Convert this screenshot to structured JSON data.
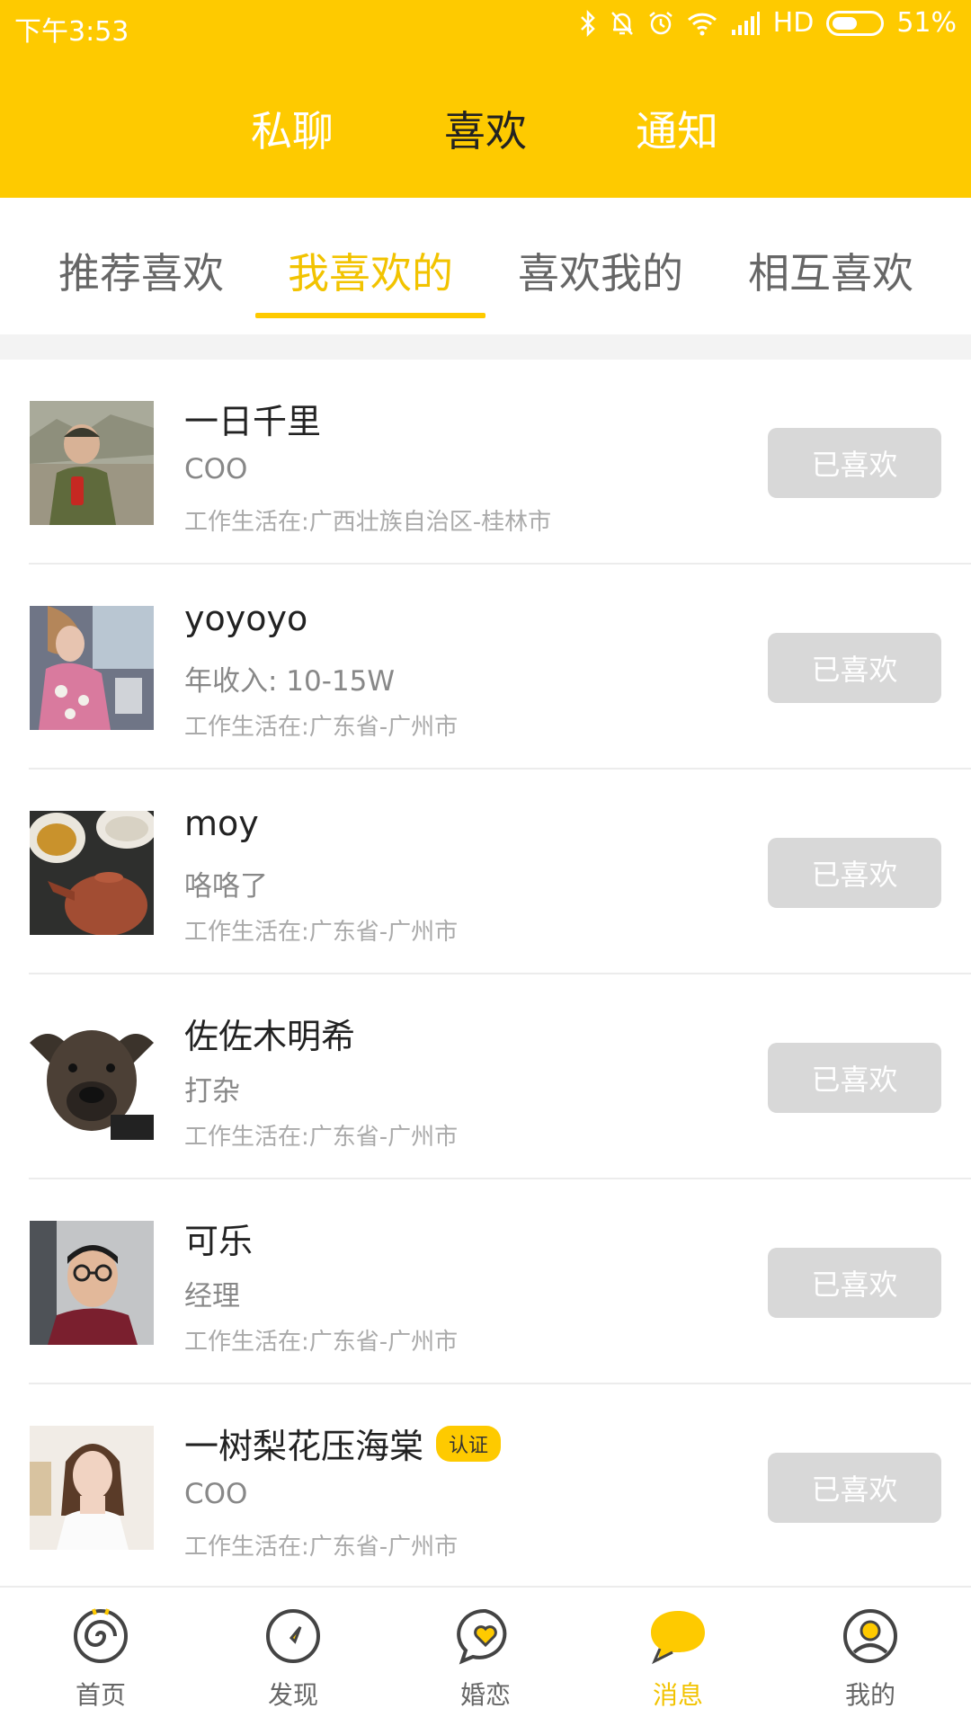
{
  "status_bar": {
    "time": "下午3:53",
    "network": "HD",
    "battery": "51%",
    "battery_level": 0.51
  },
  "top_tabs": [
    {
      "label": "私聊",
      "active": false
    },
    {
      "label": "喜欢",
      "active": true
    },
    {
      "label": "通知",
      "active": false
    }
  ],
  "sub_tabs": [
    {
      "label": "推荐喜欢",
      "active": false
    },
    {
      "label": "我喜欢的",
      "active": true
    },
    {
      "label": "喜欢我的",
      "active": false
    },
    {
      "label": "相互喜欢",
      "active": false
    }
  ],
  "list": [
    {
      "name": "一日千里",
      "badge": "",
      "subtitle": "COO",
      "location": "工作生活在:广西壮族自治区-桂林市",
      "button": "已喜欢"
    },
    {
      "name": "yoyoyo",
      "badge": "",
      "subtitle": "年收入: 10-15W",
      "location": "工作生活在:广东省-广州市",
      "button": "已喜欢"
    },
    {
      "name": "moy",
      "badge": "",
      "subtitle": "咯咯了",
      "location": "工作生活在:广东省-广州市",
      "button": "已喜欢"
    },
    {
      "name": "佐佐木明希",
      "badge": "",
      "subtitle": "打杂",
      "location": "工作生活在:广东省-广州市",
      "button": "已喜欢"
    },
    {
      "name": "可乐",
      "badge": "",
      "subtitle": "经理",
      "location": "工作生活在:广东省-广州市",
      "button": "已喜欢"
    },
    {
      "name": "一树梨花压海棠",
      "badge": "认证",
      "subtitle": "COO",
      "location": "工作生活在:广东省-广州市",
      "button": "已喜欢"
    }
  ],
  "bottom_nav": [
    {
      "label": "首页",
      "icon": "home-spiral-icon",
      "active": false
    },
    {
      "label": "发现",
      "icon": "compass-icon",
      "active": false
    },
    {
      "label": "婚恋",
      "icon": "heart-chat-icon",
      "active": false
    },
    {
      "label": "消息",
      "icon": "message-bubble-icon",
      "active": true
    },
    {
      "label": "我的",
      "icon": "profile-icon",
      "active": false
    }
  ],
  "colors": {
    "brand": "#FECA00",
    "active_text": "#F2C300",
    "button_disabled": "#d8d8d8"
  }
}
